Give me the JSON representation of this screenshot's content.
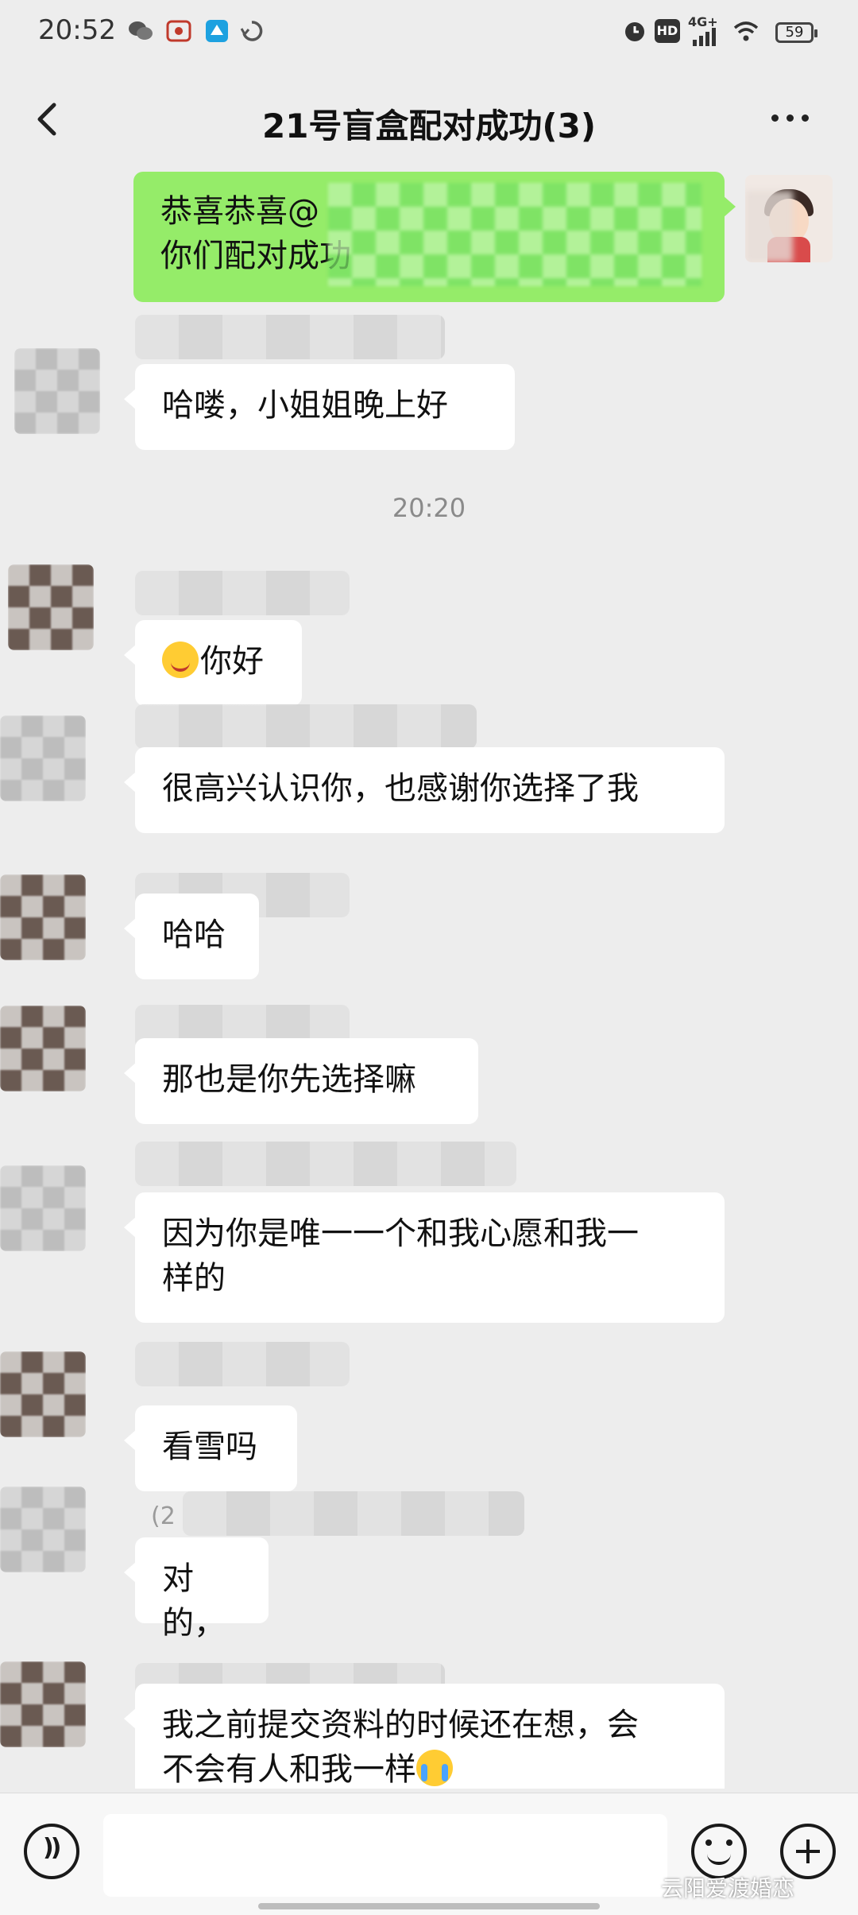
{
  "status_bar": {
    "time": "20:52",
    "network": "4G+",
    "hd": "HD",
    "battery": "59"
  },
  "header": {
    "title": "21号盲盒配对成功(3)"
  },
  "messages": [
    {
      "side": "self",
      "lines": [
        "恭喜恭喜@",
        "你们配对成功"
      ]
    },
    {
      "side": "left",
      "text": "哈喽，小姐姐晚上好"
    },
    {
      "timestamp": "20:20"
    },
    {
      "side": "left",
      "emoji": "smile",
      "text": "你好"
    },
    {
      "side": "left",
      "text": "很高兴认识你，也感谢你选择了我"
    },
    {
      "side": "left",
      "text": "哈哈"
    },
    {
      "side": "left",
      "text": "那也是你先选择嘛"
    },
    {
      "side": "left",
      "lines": [
        "因为你是唯一一个和我心愿和我一",
        "样的"
      ]
    },
    {
      "side": "left",
      "text": "看雪吗"
    },
    {
      "side": "left",
      "name_partial": "(2",
      "text": "对的，"
    },
    {
      "side": "left",
      "lines": [
        "我之前提交资料的时候还在想，会",
        "不会有人和我一样"
      ],
      "emoji": "cry"
    }
  ],
  "footer": {
    "watermark": "云阳爱渡婚恋"
  }
}
